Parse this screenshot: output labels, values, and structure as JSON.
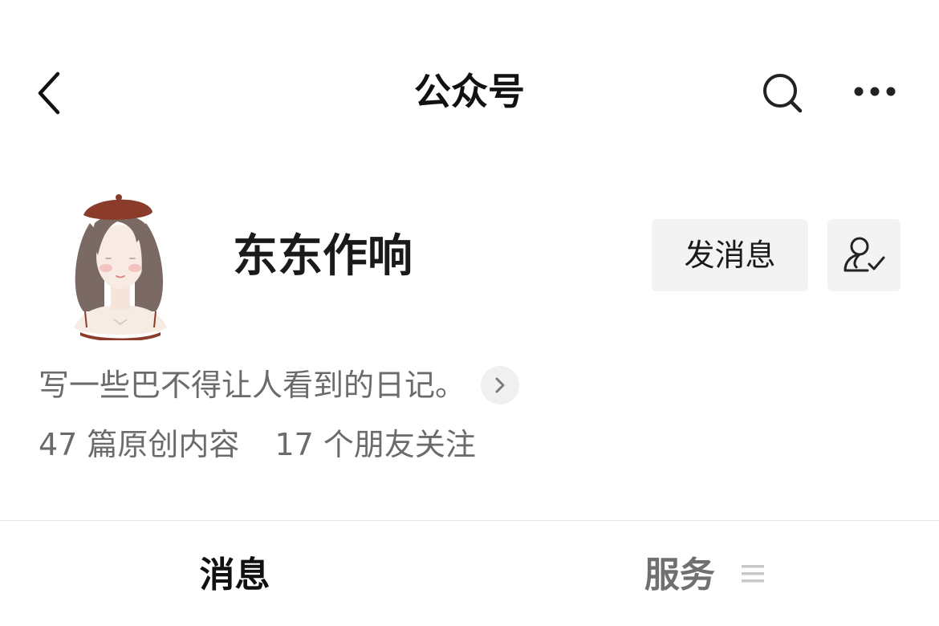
{
  "nav": {
    "title": "公众号",
    "back_icon": "chevron-left-icon",
    "search_icon": "search-icon",
    "more_icon": "more-horizontal-icon"
  },
  "profile": {
    "avatar_icon": "avatar-illustration",
    "name": "东东作响",
    "send_message_label": "发消息",
    "follow_icon": "person-check-icon",
    "description": "写一些巴不得让人看到的日记。",
    "description_more_icon": "chevron-right-icon",
    "stats": {
      "original_content": "47 篇原创内容",
      "friends_following": "17 个朋友关注"
    }
  },
  "tabs": {
    "messages": "消息",
    "services": "服务",
    "services_menu_icon": "menu-lines-icon"
  },
  "colors": {
    "button_bg": "#f3f3f3",
    "secondary_text": "#6b6b6b",
    "divider": "#e6e6e6"
  }
}
